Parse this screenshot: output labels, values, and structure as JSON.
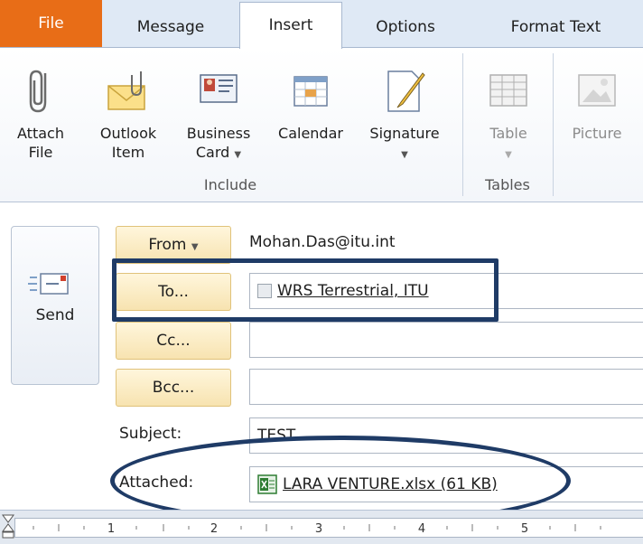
{
  "tabs": {
    "file": "File",
    "message": "Message",
    "insert": "Insert",
    "options": "Options",
    "format_text": "Format Text"
  },
  "ribbon": {
    "include": {
      "label": "Include",
      "attach_file": [
        "Attach",
        "File"
      ],
      "outlook_item": [
        "Outlook",
        "Item"
      ],
      "business_card": [
        "Business",
        "Card"
      ],
      "calendar": "Calendar",
      "signature": "Signature"
    },
    "tables": {
      "label": "Tables",
      "table": "Table"
    },
    "picture": "Picture"
  },
  "compose": {
    "send_label": "Send",
    "from_label": "From",
    "from_address": "Mohan.Das@itu.int",
    "to_label": "To...",
    "to_recipient": "WRS Terrestrial, ITU",
    "cc_label": "Cc...",
    "bcc_label": "Bcc...",
    "subject_label": "Subject:",
    "subject_value": "TEST",
    "attached_label": "Attached:",
    "attachment": "LARA VENTURE.xlsx (61 KB)"
  },
  "ruler": {
    "numbers": [
      "1",
      "2",
      "3",
      "4",
      "5"
    ]
  },
  "colors": {
    "file_tab": "#e86d17",
    "field_button": "#f7e3b0",
    "highlight": "#1f3b66"
  }
}
